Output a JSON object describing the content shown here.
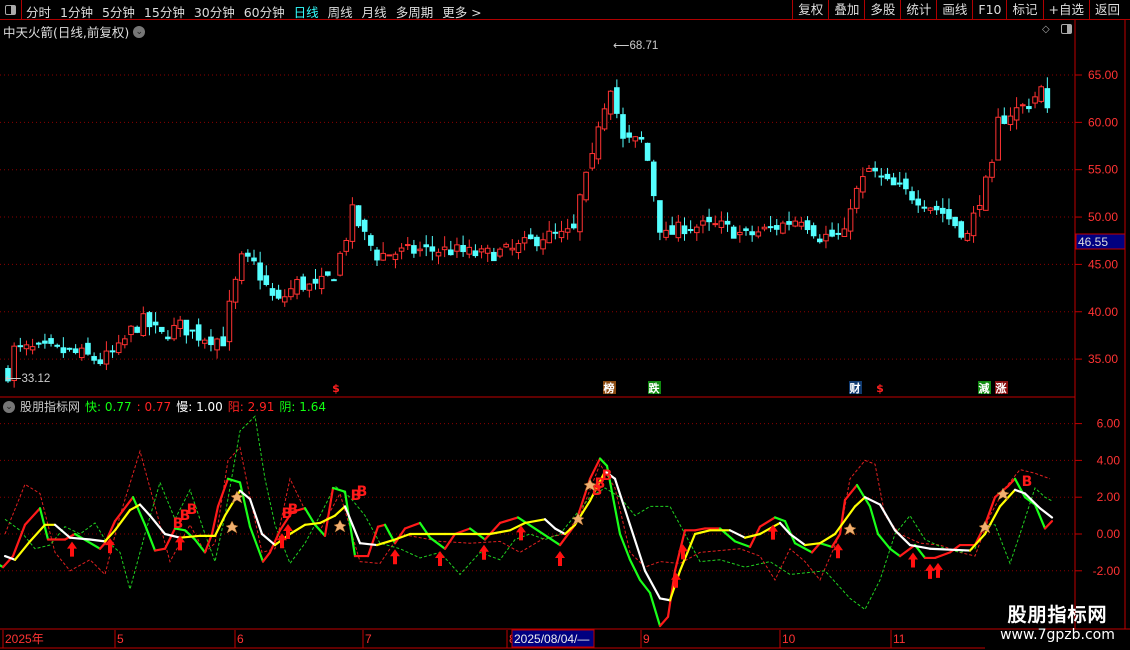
{
  "toolbar": {
    "periods": [
      "分时",
      "1分钟",
      "5分钟",
      "15分钟",
      "30分钟",
      "60分钟",
      "日线",
      "周线",
      "月线",
      "多周期",
      "更多 >"
    ],
    "active_period": "日线",
    "buttons": [
      "复权",
      "叠加",
      "多股",
      "统计",
      "画线",
      "F10",
      "标记",
      "+自选",
      "返回"
    ]
  },
  "chart_title": "中天火箭(日线,前复权)",
  "price_axis": {
    "ticks": [
      "65.00",
      "60.00",
      "55.00",
      "50.00",
      "45.00",
      "40.00",
      "35.00"
    ],
    "current_price": "46.55"
  },
  "price_labels": {
    "high": "68.71",
    "low": "33.12"
  },
  "signal_tags": [
    {
      "text": "$",
      "bg": "",
      "color": "#ff2020"
    },
    {
      "text": "榜",
      "bg": "#8a4a10",
      "color": "#fff"
    },
    {
      "text": "跌",
      "bg": "#108a10",
      "color": "#fff"
    },
    {
      "text": "财",
      "bg": "#103a70",
      "color": "#fff"
    },
    {
      "text": "$",
      "bg": "",
      "color": "#ff2020"
    },
    {
      "text": "減",
      "bg": "#108a10",
      "color": "#fff"
    },
    {
      "text": "涨",
      "bg": "#8a1010",
      "color": "#fff"
    }
  ],
  "indicator": {
    "name": "股朋指标网",
    "fast_label": "快:",
    "fast_value": "0.77",
    "fast2_value": ": 0.77",
    "slow_label": "慢:",
    "slow_value": "1.00",
    "yang_label": "阳:",
    "yang_value": "2.91",
    "yin_label": "阴:",
    "yin_value": "1.64",
    "axis_ticks": [
      "6.00",
      "4.00",
      "2.00",
      "0.00",
      "-2.00"
    ],
    "buy_marker": "B"
  },
  "date_axis": {
    "labels": [
      "2025年",
      "5",
      "6",
      "7",
      "8",
      "9",
      "10",
      "11"
    ],
    "cursor_date": "2025/08/04/—"
  },
  "watermark": {
    "name": "股朋指标网",
    "url": "www.7gpzb.com"
  },
  "colors": {
    "up": "#ff3232",
    "down": "#54ffff",
    "grid": "#8b0000",
    "fast_up": "#ff1a1a",
    "fast_down": "#1aff1a",
    "slow_up": "#ffff00",
    "slow_down": "#ffffff"
  },
  "chart_data": {
    "type": "candlestick",
    "price_range": [
      31,
      70
    ],
    "candle_count": 170,
    "close_path": [
      [
        0,
        33.5
      ],
      [
        1,
        36
      ],
      [
        7,
        36
      ],
      [
        12,
        35.5
      ],
      [
        15,
        34.8
      ],
      [
        18,
        36
      ],
      [
        20,
        38
      ],
      [
        22,
        39
      ],
      [
        25,
        37.5
      ],
      [
        28,
        38.5
      ],
      [
        31,
        37.5
      ],
      [
        35,
        37
      ],
      [
        36,
        40.5
      ],
      [
        38,
        45.5
      ],
      [
        40,
        45
      ],
      [
        43,
        41.5
      ],
      [
        44,
        41
      ],
      [
        47,
        43
      ],
      [
        50,
        42.5
      ],
      [
        53,
        44
      ],
      [
        55,
        48
      ],
      [
        56,
        50.5
      ],
      [
        58,
        48
      ],
      [
        60,
        46
      ],
      [
        67,
        46.5
      ],
      [
        72,
        46.5
      ],
      [
        77,
        46
      ],
      [
        82,
        46.5
      ],
      [
        87,
        48
      ],
      [
        90,
        48
      ],
      [
        92,
        48.5
      ],
      [
        93,
        52
      ],
      [
        95,
        56
      ],
      [
        96,
        60
      ],
      [
        98,
        64
      ],
      [
        100,
        58
      ],
      [
        103,
        58
      ],
      [
        104,
        56
      ],
      [
        106,
        49
      ],
      [
        107,
        48
      ],
      [
        110,
        49
      ],
      [
        116,
        49
      ],
      [
        120,
        48
      ],
      [
        125,
        49
      ],
      [
        129,
        50
      ],
      [
        132,
        48
      ],
      [
        136,
        48
      ],
      [
        137,
        51.5
      ],
      [
        140,
        55
      ],
      [
        143,
        53.5
      ],
      [
        148,
        52
      ],
      [
        152,
        50.5
      ],
      [
        156,
        48
      ],
      [
        158,
        52
      ],
      [
        160,
        55
      ],
      [
        161,
        60
      ],
      [
        163,
        61
      ],
      [
        166,
        62
      ],
      [
        168,
        63.5
      ],
      [
        169,
        61
      ]
    ],
    "indicator_range": [
      -5.5,
      7.5
    ],
    "fast": [
      [
        0,
        -1.7
      ],
      [
        3,
        -1.8
      ],
      [
        13,
        -1.2
      ],
      [
        25,
        0.5
      ],
      [
        40,
        1.4
      ],
      [
        48,
        -0.3
      ],
      [
        65,
        -0.3
      ],
      [
        75,
        0
      ],
      [
        100,
        -0.8
      ],
      [
        105,
        -0.5
      ],
      [
        115,
        0.7
      ],
      [
        133,
        2.0
      ],
      [
        145,
        0.5
      ],
      [
        155,
        -0.9
      ],
      [
        165,
        -0.8
      ],
      [
        175,
        0.3
      ],
      [
        185,
        0.2
      ],
      [
        195,
        -0.3
      ],
      [
        205,
        -1.0
      ],
      [
        212,
        0
      ],
      [
        218,
        1.5
      ],
      [
        228,
        3.0
      ],
      [
        240,
        2.8
      ],
      [
        250,
        0.4
      ],
      [
        263,
        -1.5
      ],
      [
        270,
        -1.0
      ],
      [
        280,
        0.2
      ],
      [
        292,
        1.2
      ],
      [
        305,
        1.4
      ],
      [
        315,
        0.5
      ],
      [
        325,
        -0.1
      ],
      [
        333,
        2.5
      ],
      [
        345,
        2.3
      ],
      [
        355,
        -1.2
      ],
      [
        368,
        -1.2
      ],
      [
        378,
        0.4
      ],
      [
        385,
        0.5
      ],
      [
        395,
        -0.5
      ],
      [
        405,
        0.3
      ],
      [
        420,
        0.6
      ],
      [
        430,
        -0.2
      ],
      [
        445,
        -0.8
      ],
      [
        455,
        0
      ],
      [
        470,
        0.3
      ],
      [
        485,
        -0.3
      ],
      [
        500,
        0.6
      ],
      [
        518,
        0.9
      ],
      [
        560,
        -0.6
      ],
      [
        575,
        0.5
      ],
      [
        590,
        3.0
      ],
      [
        600,
        4.1
      ],
      [
        607,
        3.7
      ],
      [
        620,
        0
      ],
      [
        630,
        -1.4
      ],
      [
        640,
        -2.5
      ],
      [
        650,
        -3.2
      ],
      [
        660,
        -5.0
      ],
      [
        668,
        -4.5
      ],
      [
        675,
        -2.0
      ],
      [
        685,
        0.2
      ],
      [
        695,
        0.2
      ],
      [
        705,
        0.3
      ],
      [
        720,
        0.3
      ],
      [
        735,
        -0.4
      ],
      [
        750,
        -0.7
      ],
      [
        760,
        0.4
      ],
      [
        775,
        0.9
      ],
      [
        785,
        0.7
      ],
      [
        795,
        -0.5
      ],
      [
        812,
        -1.0
      ],
      [
        820,
        -0.5
      ],
      [
        832,
        -0.7
      ],
      [
        840,
        0
      ],
      [
        845,
        1.85
      ],
      [
        857,
        2.66
      ],
      [
        870,
        1.5
      ],
      [
        878,
        0
      ],
      [
        890,
        -0.8
      ],
      [
        900,
        -1.2
      ],
      [
        915,
        -0.6
      ],
      [
        925,
        -1.3
      ],
      [
        935,
        -1.3
      ],
      [
        950,
        -1.0
      ],
      [
        960,
        -0.6
      ],
      [
        975,
        -0.6
      ],
      [
        985,
        0.5
      ],
      [
        995,
        2.0
      ],
      [
        1008,
        2.6
      ],
      [
        1015,
        3.0
      ],
      [
        1025,
        2.0
      ],
      [
        1035,
        1.6
      ],
      [
        1045,
        0.3
      ],
      [
        1052,
        0.7
      ]
    ],
    "slow": [
      [
        5,
        -1.2
      ],
      [
        15,
        -1.4
      ],
      [
        30,
        -0.4
      ],
      [
        45,
        0.5
      ],
      [
        55,
        0.5
      ],
      [
        70,
        -0.2
      ],
      [
        90,
        -0.3
      ],
      [
        105,
        -0.4
      ],
      [
        115,
        0.2
      ],
      [
        130,
        1.3
      ],
      [
        140,
        1.6
      ],
      [
        150,
        1.0
      ],
      [
        165,
        0
      ],
      [
        180,
        -0.2
      ],
      [
        200,
        -0.1
      ],
      [
        215,
        -0.1
      ],
      [
        225,
        1.0
      ],
      [
        240,
        2.35
      ],
      [
        250,
        1.9
      ],
      [
        262,
        0
      ],
      [
        275,
        -0.6
      ],
      [
        290,
        0
      ],
      [
        305,
        0.5
      ],
      [
        320,
        0.6
      ],
      [
        335,
        1.0
      ],
      [
        345,
        1.5
      ],
      [
        360,
        -0.5
      ],
      [
        377,
        -0.6
      ],
      [
        395,
        -0.3
      ],
      [
        410,
        0
      ],
      [
        445,
        0
      ],
      [
        490,
        0
      ],
      [
        510,
        0.2
      ],
      [
        525,
        0.6
      ],
      [
        545,
        0.8
      ],
      [
        555,
        0.3
      ],
      [
        565,
        0
      ],
      [
        575,
        0.5
      ],
      [
        590,
        1.8
      ],
      [
        605,
        3.4
      ],
      [
        615,
        3.0
      ],
      [
        630,
        0.5
      ],
      [
        645,
        -2.0
      ],
      [
        660,
        -3.5
      ],
      [
        670,
        -3.6
      ],
      [
        680,
        -2.0
      ],
      [
        695,
        0
      ],
      [
        710,
        0.2
      ],
      [
        730,
        0.2
      ],
      [
        745,
        -0.2
      ],
      [
        760,
        0
      ],
      [
        780,
        0.6
      ],
      [
        790,
        0
      ],
      [
        805,
        -0.6
      ],
      [
        820,
        -0.5
      ],
      [
        835,
        0
      ],
      [
        855,
        1.5
      ],
      [
        865,
        2.0
      ],
      [
        880,
        1.6
      ],
      [
        895,
        0.2
      ],
      [
        910,
        -0.6
      ],
      [
        930,
        -0.8
      ],
      [
        970,
        -0.9
      ],
      [
        985,
        0
      ],
      [
        1000,
        1.5
      ],
      [
        1015,
        2.4
      ],
      [
        1025,
        2.2
      ],
      [
        1040,
        1.4
      ],
      [
        1052,
        0.9
      ]
    ],
    "yang_dashed": [
      [
        5,
        0
      ],
      [
        25,
        2.7
      ],
      [
        40,
        2.2
      ],
      [
        55,
        -1.0
      ],
      [
        70,
        -2.0
      ],
      [
        90,
        -1.4
      ],
      [
        105,
        -2.2
      ],
      [
        120,
        1.0
      ],
      [
        140,
        4.5
      ],
      [
        155,
        1.5
      ],
      [
        170,
        -1.5
      ],
      [
        190,
        0.5
      ],
      [
        205,
        -1.0
      ],
      [
        215,
        -0.5
      ],
      [
        228,
        4.0
      ],
      [
        240,
        4.7
      ],
      [
        250,
        2.0
      ],
      [
        262,
        -1.0
      ],
      [
        275,
        -0.8
      ],
      [
        290,
        3.0
      ],
      [
        305,
        1.3
      ],
      [
        320,
        0.2
      ],
      [
        340,
        2.2
      ],
      [
        360,
        -1.5
      ],
      [
        380,
        -1.6
      ],
      [
        400,
        0
      ],
      [
        420,
        -0.2
      ],
      [
        440,
        -0.4
      ],
      [
        470,
        -0.5
      ],
      [
        500,
        -0.4
      ],
      [
        520,
        -1.0
      ],
      [
        545,
        -0.2
      ],
      [
        565,
        0
      ],
      [
        580,
        1.0
      ],
      [
        600,
        3.8
      ],
      [
        615,
        2.5
      ],
      [
        630,
        -1.0
      ],
      [
        645,
        -1.8
      ],
      [
        660,
        -1.5
      ],
      [
        680,
        -1.6
      ],
      [
        700,
        -1.0
      ],
      [
        740,
        -0.8
      ],
      [
        760,
        -1.2
      ],
      [
        775,
        -2.5
      ],
      [
        790,
        -0.8
      ],
      [
        805,
        -1.5
      ],
      [
        820,
        -2.5
      ],
      [
        840,
        0
      ],
      [
        850,
        3.0
      ],
      [
        865,
        4.0
      ],
      [
        875,
        3.8
      ],
      [
        885,
        1.0
      ],
      [
        900,
        0
      ],
      [
        920,
        -0.5
      ],
      [
        940,
        -0.6
      ],
      [
        960,
        -1.0
      ],
      [
        975,
        -1.2
      ],
      [
        990,
        1.0
      ],
      [
        1005,
        2.5
      ],
      [
        1020,
        3.5
      ],
      [
        1035,
        3.3
      ],
      [
        1050,
        3.0
      ]
    ],
    "yin_dashed": [
      [
        5,
        0.8
      ],
      [
        20,
        0.2
      ],
      [
        35,
        -0.8
      ],
      [
        50,
        -0.6
      ],
      [
        65,
        0.4
      ],
      [
        80,
        0
      ],
      [
        95,
        0.6
      ],
      [
        105,
        -0.3
      ],
      [
        120,
        -1.0
      ],
      [
        130,
        -3.0
      ],
      [
        145,
        0
      ],
      [
        160,
        2.8
      ],
      [
        175,
        0.8
      ],
      [
        190,
        2.4
      ],
      [
        205,
        0
      ],
      [
        215,
        -1.5
      ],
      [
        225,
        1.0
      ],
      [
        240,
        5.6
      ],
      [
        255,
        6.4
      ],
      [
        265,
        3.0
      ],
      [
        275,
        0.5
      ],
      [
        290,
        -1.6
      ],
      [
        305,
        -0.5
      ],
      [
        320,
        1.0
      ],
      [
        335,
        2.6
      ],
      [
        350,
        2.0
      ],
      [
        365,
        1.0
      ],
      [
        380,
        -0.5
      ],
      [
        400,
        -0.8
      ],
      [
        420,
        -1.3
      ],
      [
        440,
        -1.0
      ],
      [
        460,
        -2.2
      ],
      [
        480,
        -1.0
      ],
      [
        500,
        -1.4
      ],
      [
        515,
        -0.3
      ],
      [
        530,
        0
      ],
      [
        545,
        -0.3
      ],
      [
        560,
        0
      ],
      [
        575,
        1.0
      ],
      [
        590,
        2.0
      ],
      [
        605,
        2.5
      ],
      [
        620,
        2.0
      ],
      [
        635,
        1.0
      ],
      [
        650,
        1.5
      ],
      [
        670,
        1.5
      ],
      [
        685,
        0
      ],
      [
        700,
        -1.5
      ],
      [
        720,
        -1.4
      ],
      [
        745,
        -1.8
      ],
      [
        770,
        -1.5
      ],
      [
        790,
        -2.2
      ],
      [
        825,
        -2.0
      ],
      [
        850,
        -3.5
      ],
      [
        865,
        -4.1
      ],
      [
        880,
        -2.5
      ],
      [
        895,
        0
      ],
      [
        910,
        1.0
      ],
      [
        925,
        -0.3
      ],
      [
        945,
        -0.8
      ],
      [
        960,
        -1.0
      ],
      [
        975,
        -0.8
      ],
      [
        985,
        0.5
      ],
      [
        995,
        0.5
      ],
      [
        1010,
        -1.6
      ],
      [
        1020,
        0
      ],
      [
        1035,
        2.5
      ],
      [
        1045,
        2.0
      ],
      [
        1052,
        1.8
      ]
    ]
  }
}
